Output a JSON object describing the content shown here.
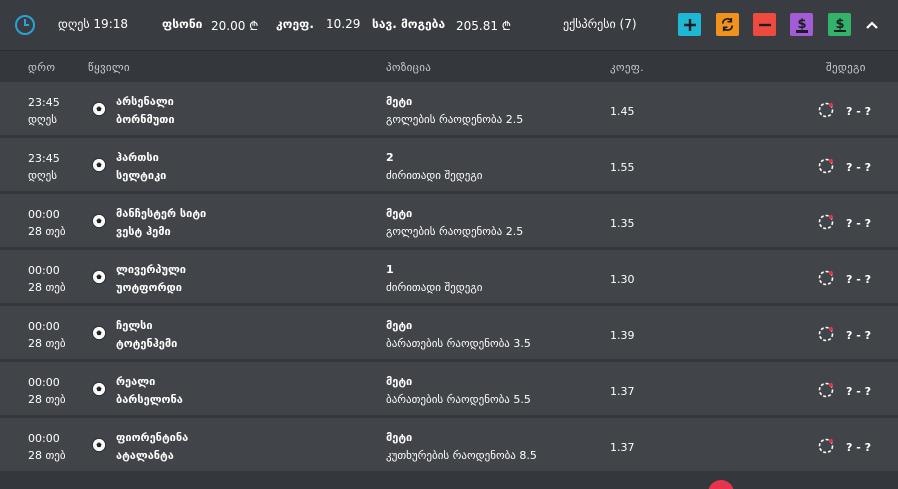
{
  "header": {
    "time": "დღეს 19:18",
    "stake_label": "ფსონი",
    "stake_value": "20.00 ₾",
    "coef_label": "კოეფ.",
    "coef_value": "10.29",
    "possible_win_label": "სავ. მოგება",
    "possible_win_value": "205.81 ₾",
    "express_label": "ექსპრესი (7)",
    "buttons": [
      {
        "name": "add",
        "color": "#1fb8d4"
      },
      {
        "name": "refresh",
        "color": "#f0921d"
      },
      {
        "name": "remove",
        "color": "#ee4b3e"
      },
      {
        "name": "dollar-purple",
        "color": "#a35bd6"
      },
      {
        "name": "dollar-green",
        "color": "#33b36a"
      }
    ]
  },
  "columns": {
    "time": "დრო",
    "pair": "წყვილი",
    "position": "პოზიცია",
    "coef": "კოეფ.",
    "result": "შედეგი"
  },
  "rows": [
    {
      "time1": "23:45",
      "time2": "დღეს",
      "home": "არსენალი",
      "away": "ბორნმუთი",
      "pos1": "მეტი",
      "pos2": "გოლების რაოდენობა 2.5",
      "odd": "1.45",
      "score": "? - ?"
    },
    {
      "time1": "23:45",
      "time2": "დღეს",
      "home": "ჰართსი",
      "away": "სელტიკი",
      "pos1": "2",
      "pos2": "ძირითადი შედეგი",
      "odd": "1.55",
      "score": "? - ?"
    },
    {
      "time1": "00:00",
      "time2": "28 თებ",
      "home": "მანჩესტერ სიტი",
      "away": "ვესტ ჰემი",
      "pos1": "მეტი",
      "pos2": "გოლების რაოდენობა 2.5",
      "odd": "1.35",
      "score": "? - ?"
    },
    {
      "time1": "00:00",
      "time2": "28 თებ",
      "home": "ლივერპული",
      "away": "უოტფორდი",
      "pos1": "1",
      "pos2": "ძირითადი შედეგი",
      "odd": "1.30",
      "score": "? - ?"
    },
    {
      "time1": "00:00",
      "time2": "28 თებ",
      "home": "ჩელსი",
      "away": "ტოტენჰემი",
      "pos1": "მეტი",
      "pos2": "ბარათების რაოდენობა 3.5",
      "odd": "1.39",
      "score": "? - ?"
    },
    {
      "time1": "00:00",
      "time2": "28 თებ",
      "home": "რეალი",
      "away": "ბარსელონა",
      "pos1": "მეტი",
      "pos2": "ბარათების რაოდენობა 5.5",
      "odd": "1.37",
      "score": "? - ?"
    },
    {
      "time1": "00:00",
      "time2": "28 თებ",
      "home": "ფიორენტინა",
      "away": "ატალანტა",
      "pos1": "მეტი",
      "pos2": "კუთხურების რაოდენობა 8.5",
      "odd": "1.37",
      "score": "? - ?"
    }
  ],
  "icons": {
    "clock": "clock-icon",
    "ball": "soccer-ball-icon",
    "pending": "pending-status-icon",
    "collapse": "chevron-up-icon"
  }
}
